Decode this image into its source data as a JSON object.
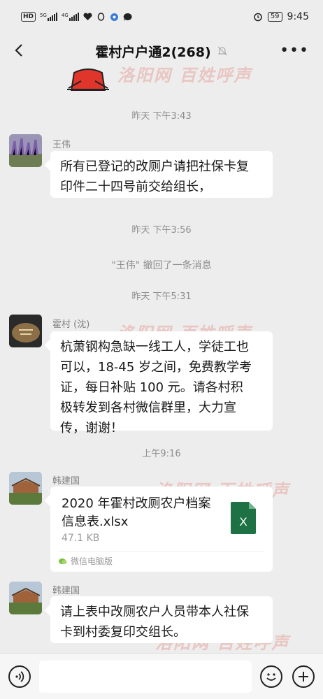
{
  "status_bar": {
    "left_chip": "HD",
    "signal_1_label": "5G",
    "signal_2_label": "4G",
    "battery": "59",
    "time": "9:45"
  },
  "chat": {
    "title": "霍村户户通2(268)",
    "back_icon": "chevron-left-icon",
    "mute_icon": "bell-off-icon",
    "more_icon": "more-dots-icon"
  },
  "watermark": "洛阳网 百姓呼声",
  "messages": [
    {
      "type": "time",
      "text": "昨天 下午3:43"
    },
    {
      "type": "text",
      "sender": "王伟",
      "text_lines": [
        "所有已登记的改厕户请把社保卡复",
        "印件二十四号前交给组长，"
      ]
    },
    {
      "type": "time",
      "text": "昨天 下午3:56"
    },
    {
      "type": "system",
      "text": "\"王伟\" 撤回了一条消息"
    },
    {
      "type": "time",
      "text": "昨天 下午5:31"
    },
    {
      "type": "text",
      "sender": "霍村 (沈)",
      "text_lines": [
        "杭萧钢构急缺一线工人，学徒工也",
        "可以，18-45 岁之间，免费教学考",
        "证，每日补贴 100 元。请各村积",
        "极转发到各村微信群里，大力宣",
        "传，谢谢！"
      ]
    },
    {
      "type": "time",
      "text": "上午9:16"
    },
    {
      "type": "file",
      "sender": "韩建国",
      "file_name_lines": [
        "2020 年霍村改厕农户档案",
        "信息表.xlsx"
      ],
      "file_size": "47.1 KB",
      "source": "微信电脑版",
      "file_icon_letter": "X"
    },
    {
      "type": "text",
      "sender": "韩建国",
      "text_lines": [
        "请上表中改厕农户人员带本人社保",
        "卡到村委复印交组长。"
      ]
    }
  ],
  "input_bar": {
    "voice_icon": "voice-icon",
    "emoji_icon": "emoji-icon",
    "plus_icon": "plus-icon"
  },
  "colors": {
    "background": "#ededed",
    "bubble": "#ffffff",
    "excel_green": "#1e7145",
    "watermark": "#d73c28"
  }
}
